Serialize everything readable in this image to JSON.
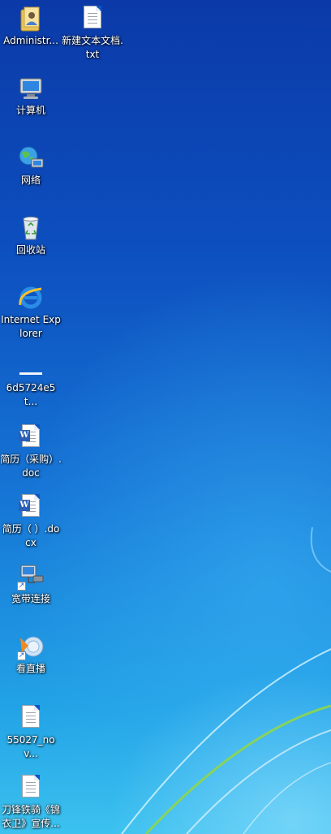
{
  "desktop": {
    "icons": [
      {
        "label": "Administr...",
        "icon": "user-folder-icon"
      },
      {
        "label": "新建文本文档.txt",
        "icon": "text-file-icon"
      },
      {
        "label": "计算机",
        "icon": "computer-icon"
      },
      {
        "label": "网络",
        "icon": "network-icon"
      },
      {
        "label": "回收站",
        "icon": "recycle-bin-icon"
      },
      {
        "label": "Internet Explorer",
        "icon": "internet-explorer-icon"
      },
      {
        "label": "6d5724e5t...",
        "icon": "blank-file-icon"
      },
      {
        "label": "简历（采购）.doc",
        "icon": "word-document-icon"
      },
      {
        "label": "简历（ ）.docx",
        "icon": "word-document-icon"
      },
      {
        "label": "宽带连接",
        "icon": "broadband-connection-icon"
      },
      {
        "label": "看直播",
        "icon": "live-stream-icon"
      },
      {
        "label": "55027_nov...",
        "icon": "text-file-icon"
      },
      {
        "label": "刀锋铁骑《锦衣卫》宣传...",
        "icon": "text-file-icon"
      }
    ]
  }
}
